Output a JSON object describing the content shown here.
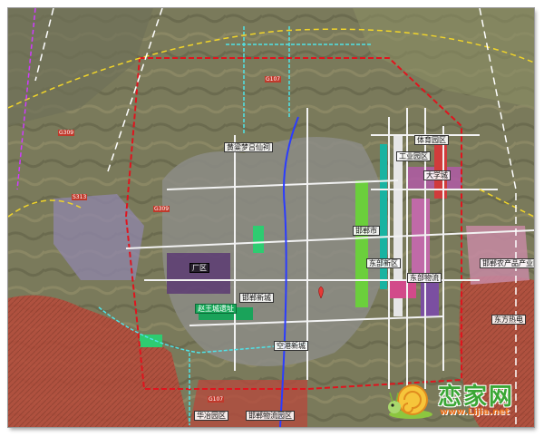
{
  "map": {
    "labels": {
      "huanghe": "黄粱梦吕仙祠",
      "zhaowang": "赵王城遗址",
      "ye": "邯郸新城",
      "handan": "邯郸市",
      "dongchengqu": "东部新区",
      "tiyu": "体育园区",
      "daxuecheng": "大学城",
      "gongye": "工业园区",
      "chanyeyuan": "邯郸农产品产业园",
      "nongye": "东部物流",
      "lierchang": "东部物流",
      "huayang": "华冶园区",
      "jiyongqu": "邯郸物流园区",
      "quyu1": "厂区",
      "dongfangchuang": "东方热电",
      "kongzhong": "空港新城"
    },
    "roads": {
      "r1": "G107",
      "r2": "G309",
      "r3": "S313",
      "r4": "G309",
      "r5": "G107"
    },
    "colors": {
      "red_zone": "#c0392b",
      "purple_zone": "#8e44ad",
      "boundary": "#e0141e",
      "arterial": "#f2f2f2",
      "green": "#2ecc71"
    }
  },
  "watermark": {
    "brand": "恋家网",
    "url": "www.Lijia.net",
    "icon": "snail-icon"
  }
}
